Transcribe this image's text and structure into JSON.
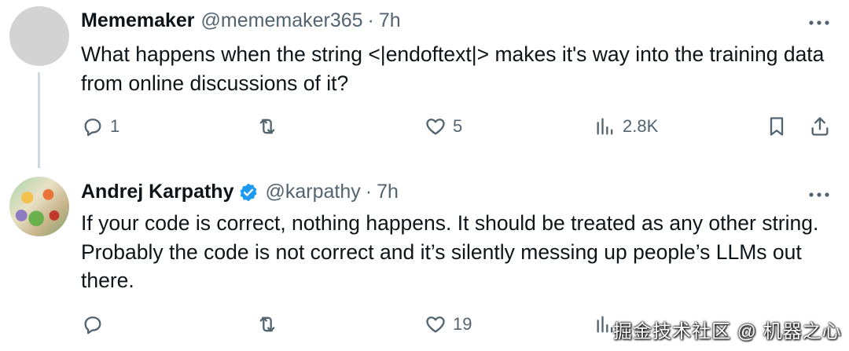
{
  "tweets": [
    {
      "name": "Mememaker",
      "handle": "@mememaker365",
      "separator": "·",
      "time": "7h",
      "text": "What happens when the string <|endoftext|> makes it's way into the training data from online discussions of it?",
      "replies": "1",
      "retweets": "",
      "likes": "5",
      "views": "2.8K"
    },
    {
      "name": "Andrej Karpathy",
      "verified": true,
      "handle": "@karpathy",
      "separator": "·",
      "time": "7h",
      "text": "If your code is correct, nothing happens. It should be treated as any other string. Probably the code is not correct and it’s silently messing up people’s LLMs out there.",
      "replies": "",
      "retweets": "",
      "likes": "19"
    }
  ],
  "watermark": "掘金技术社区 @ 机器之心",
  "colors": {
    "text": "#0f1419",
    "secondary": "#536471",
    "verified": "#1d9bf0",
    "thread_line": "#cfd9de"
  }
}
